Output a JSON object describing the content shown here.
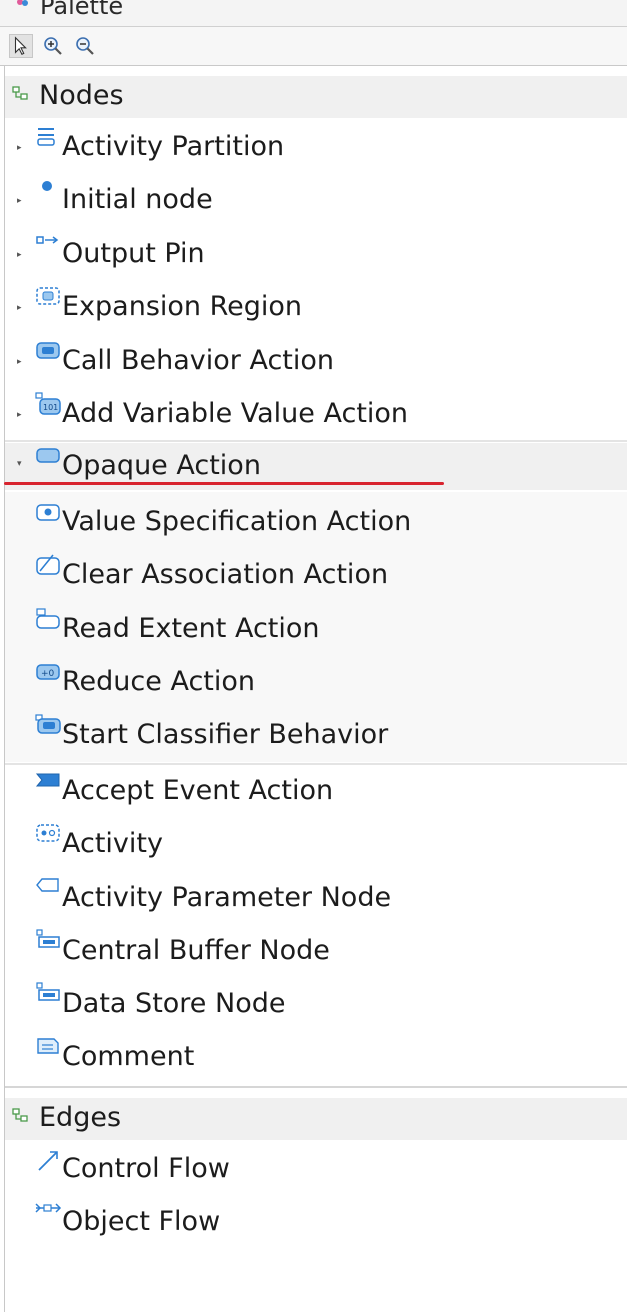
{
  "palette": {
    "title": "Palette",
    "toolbar": [
      {
        "name": "select-tool",
        "icon": "arrow-pointer-icon"
      },
      {
        "name": "zoom-in-tool",
        "icon": "zoom-in-icon"
      },
      {
        "name": "zoom-out-tool",
        "icon": "zoom-out-icon"
      }
    ],
    "drawers": {
      "nodes": {
        "label": "Nodes",
        "items": [
          {
            "label": "Activity Partition",
            "icon": "activity-partition-icon"
          },
          {
            "label": "Initial node",
            "icon": "initial-node-icon"
          },
          {
            "label": "Output Pin",
            "icon": "output-pin-icon"
          },
          {
            "label": "Expansion Region",
            "icon": "expansion-region-icon"
          },
          {
            "label": "Call Behavior Action",
            "icon": "call-behavior-action-icon"
          },
          {
            "label": "Add Variable Value Action",
            "icon": "add-variable-value-action-icon"
          },
          {
            "label": "Opaque Action",
            "icon": "opaque-action-icon"
          },
          {
            "label": "Value Specification Action",
            "icon": "value-specification-action-icon"
          },
          {
            "label": "Clear Association Action",
            "icon": "clear-association-action-icon"
          },
          {
            "label": "Read Extent Action",
            "icon": "read-extent-action-icon"
          },
          {
            "label": "Reduce Action",
            "icon": "reduce-action-icon"
          },
          {
            "label": "Start Classifier Behavior",
            "icon": "start-classifier-behavior-icon"
          },
          {
            "label": "Accept Event Action",
            "icon": "accept-event-action-icon"
          },
          {
            "label": "Activity",
            "icon": "activity-icon"
          },
          {
            "label": "Activity Parameter Node",
            "icon": "activity-parameter-node-icon"
          },
          {
            "label": "Central Buffer Node",
            "icon": "central-buffer-node-icon"
          },
          {
            "label": "Data Store Node",
            "icon": "data-store-node-icon"
          },
          {
            "label": "Comment",
            "icon": "comment-icon"
          }
        ]
      },
      "edges": {
        "label": "Edges",
        "items": [
          {
            "label": "Control Flow",
            "icon": "control-flow-icon"
          },
          {
            "label": "Object Flow",
            "icon": "object-flow-icon"
          }
        ]
      }
    },
    "expanded_stack": "Opaque Action",
    "colors": {
      "annotation_underline": "#d8242f",
      "icon_blue": "#2d7fd3",
      "drawer_bg": "#f0f0f0"
    }
  }
}
